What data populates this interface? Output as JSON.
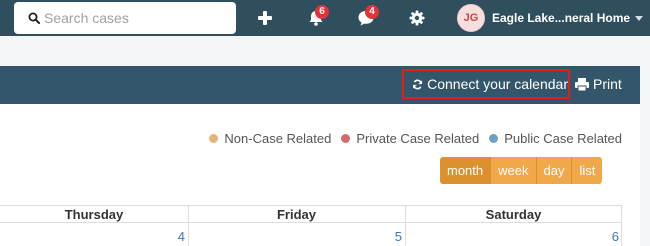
{
  "search": {
    "placeholder": "Search cases",
    "value": ""
  },
  "nav": {
    "notifications_badge": "6",
    "messages_badge": "4"
  },
  "user": {
    "initials": "JG",
    "name": "Eagle Lake...neral Home"
  },
  "header": {
    "connect_label": "Connect your calendar",
    "print_label": "Print"
  },
  "legend": [
    {
      "label": "Non-Case Related",
      "color": "#e3b57a"
    },
    {
      "label": "Private Case Related",
      "color": "#d46a6a"
    },
    {
      "label": "Public Case Related",
      "color": "#6e9ec2"
    }
  ],
  "views": [
    "month",
    "week",
    "day",
    "list"
  ],
  "active_view": "month",
  "calendar": {
    "days": [
      {
        "name": "Thursday",
        "date": "4"
      },
      {
        "name": "Friday",
        "date": "5"
      },
      {
        "name": "Saturday",
        "date": "6"
      }
    ]
  },
  "colors": {
    "topbar": "#2f4f5f",
    "accent": "#f0a848",
    "highlight": "#e0201c"
  }
}
